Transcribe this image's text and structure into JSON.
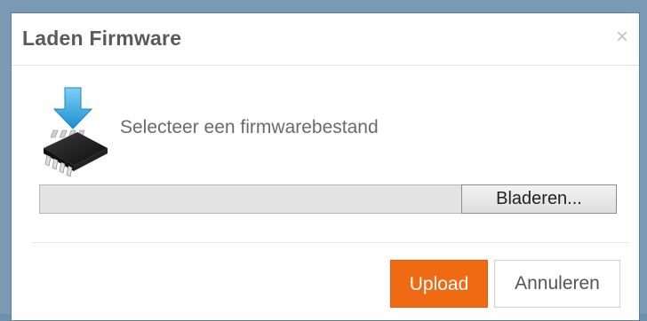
{
  "dialog": {
    "title": "Laden Firmware",
    "close_symbol": "×",
    "prompt": "Selecteer een firmwarebestand",
    "icon": "firmware-chip-download-icon",
    "file_field_value": "",
    "browse_label": "Bladeren...",
    "upload_label": "Upload",
    "cancel_label": "Annuleren"
  },
  "colors": {
    "backdrop": "#7a99b5",
    "upload_button": "#ef6a13",
    "title_text": "#5a5a5a",
    "download_arrow": "#29a9e0"
  }
}
